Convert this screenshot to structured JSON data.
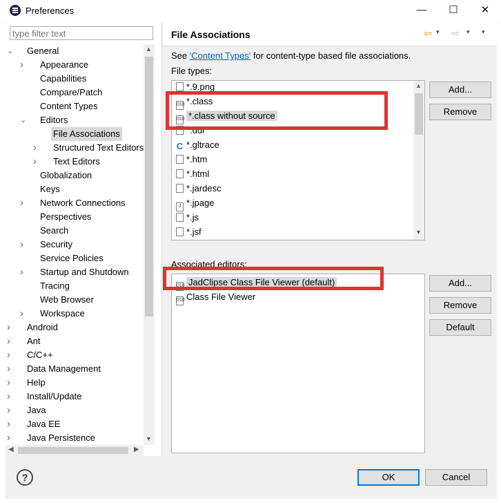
{
  "window": {
    "title": "Preferences",
    "minimize": "—",
    "maximize": "☐",
    "close": "✕"
  },
  "left": {
    "filter_placeholder": "type filter text",
    "tree": [
      {
        "label": "General",
        "depth": 0,
        "twisty": "open"
      },
      {
        "label": "Appearance",
        "depth": 1,
        "twisty": "closed"
      },
      {
        "label": "Capabilities",
        "depth": 1,
        "twisty": "none"
      },
      {
        "label": "Compare/Patch",
        "depth": 1,
        "twisty": "none"
      },
      {
        "label": "Content Types",
        "depth": 1,
        "twisty": "none"
      },
      {
        "label": "Editors",
        "depth": 1,
        "twisty": "open"
      },
      {
        "label": "File Associations",
        "depth": 2,
        "twisty": "none",
        "selected": true
      },
      {
        "label": "Structured Text Editors",
        "depth": 2,
        "twisty": "closed"
      },
      {
        "label": "Text Editors",
        "depth": 2,
        "twisty": "closed"
      },
      {
        "label": "Globalization",
        "depth": 1,
        "twisty": "none"
      },
      {
        "label": "Keys",
        "depth": 1,
        "twisty": "none"
      },
      {
        "label": "Network Connections",
        "depth": 1,
        "twisty": "closed"
      },
      {
        "label": "Perspectives",
        "depth": 1,
        "twisty": "none"
      },
      {
        "label": "Search",
        "depth": 1,
        "twisty": "none"
      },
      {
        "label": "Security",
        "depth": 1,
        "twisty": "closed"
      },
      {
        "label": "Service Policies",
        "depth": 1,
        "twisty": "none"
      },
      {
        "label": "Startup and Shutdown",
        "depth": 1,
        "twisty": "closed"
      },
      {
        "label": "Tracing",
        "depth": 1,
        "twisty": "none"
      },
      {
        "label": "Web Browser",
        "depth": 1,
        "twisty": "none"
      },
      {
        "label": "Workspace",
        "depth": 1,
        "twisty": "closed"
      },
      {
        "label": "Android",
        "depth": 0,
        "twisty": "closed"
      },
      {
        "label": "Ant",
        "depth": 0,
        "twisty": "closed"
      },
      {
        "label": "C/C++",
        "depth": 0,
        "twisty": "closed"
      },
      {
        "label": "Data Management",
        "depth": 0,
        "twisty": "closed"
      },
      {
        "label": "Help",
        "depth": 0,
        "twisty": "closed"
      },
      {
        "label": "Install/Update",
        "depth": 0,
        "twisty": "closed"
      },
      {
        "label": "Java",
        "depth": 0,
        "twisty": "closed"
      },
      {
        "label": "Java EE",
        "depth": 0,
        "twisty": "closed"
      },
      {
        "label": "Java Persistence",
        "depth": 0,
        "twisty": "closed"
      }
    ]
  },
  "page": {
    "title": "File Associations",
    "desc_prefix": "See ",
    "desc_link": "'Content Types'",
    "desc_suffix": " for content-type based file associations.",
    "file_types_label": "File types:",
    "file_types": [
      {
        "name": "*.9.png",
        "icon": "image-file-icon"
      },
      {
        "name": "*.class",
        "icon": "class-file-icon"
      },
      {
        "name": "*.class without source",
        "icon": "class-file-icon",
        "selected": true
      },
      {
        "name": "*.ddl",
        "icon": "ddl-file-icon"
      },
      {
        "name": "*.gltrace",
        "icon": "gltrace-file-icon"
      },
      {
        "name": "*.htm",
        "icon": "html-file-icon"
      },
      {
        "name": "*.html",
        "icon": "html-file-icon"
      },
      {
        "name": "*.jardesc",
        "icon": "jardesc-file-icon"
      },
      {
        "name": "*.jpage",
        "icon": "jpage-file-icon"
      },
      {
        "name": "*.js",
        "icon": "js-file-icon"
      },
      {
        "name": "*.jsf",
        "icon": "jsf-file-icon"
      }
    ],
    "file_buttons": {
      "add": "Add...",
      "remove": "Remove"
    },
    "editors_label": "Associated editors:",
    "editors": [
      {
        "name": "JadClipse Class File Viewer (default)",
        "icon": "class-file-icon",
        "selected": true
      },
      {
        "name": "Class File Viewer",
        "icon": "class-file-icon"
      }
    ],
    "editor_buttons": {
      "add": "Add...",
      "remove": "Remove",
      "default": "Default"
    }
  },
  "footer": {
    "ok": "OK",
    "cancel": "Cancel"
  },
  "colors": {
    "annotation_red": "#e23131",
    "accent": "#0078d7"
  }
}
